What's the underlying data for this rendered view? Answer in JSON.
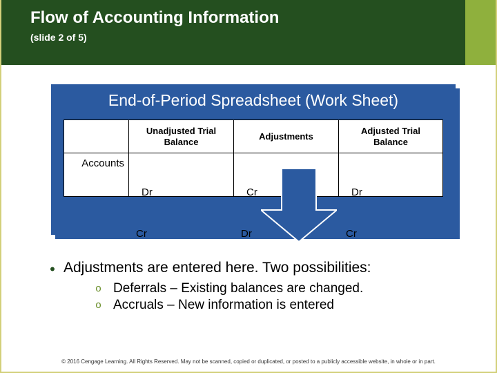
{
  "header": {
    "title": "Flow of Accounting Information",
    "subtitle": "(slide 2 of 5)"
  },
  "worksheet": {
    "title": "End-of-Period Spreadsheet (Work Sheet)",
    "columns": {
      "accounts": "Accounts",
      "unadjusted": "Unadjusted Trial Balance",
      "adjustments": "Adjustments",
      "adjusted": "Adjusted Trial Balance"
    },
    "cells": {
      "c1r1": "Dr",
      "c1r2": "Cr",
      "c2r1": "Cr",
      "c2r2": "Dr",
      "c3r1": "Dr",
      "c3r2": "Cr"
    }
  },
  "bullets": {
    "main": "Adjustments are entered here. Two possibilities:",
    "sub1": "Deferrals – Existing balances are changed.",
    "sub2": "Accruals – New information is entered"
  },
  "footer": "© 2016 Cengage Learning. All Rights Reserved. May not be scanned, copied or duplicated, or posted to a publicly accessible website, in whole or in part."
}
